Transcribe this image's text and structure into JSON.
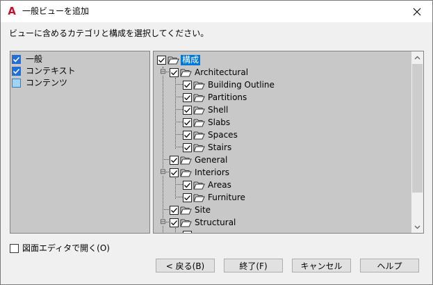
{
  "window": {
    "title": "一般ビューを追加",
    "logo_letter": "A",
    "close_icon": "close-icon"
  },
  "instruction": "ビューに含めるカテゴリと構成を選択してください。",
  "categories": [
    {
      "label": "一般",
      "checked": true
    },
    {
      "label": "コンテキスト",
      "checked": true
    },
    {
      "label": "コンテンツ",
      "checked": false
    }
  ],
  "tree": {
    "root": {
      "label": "構成",
      "checked": true,
      "selected": true
    },
    "nodes": [
      {
        "label": "Architectural",
        "checked": true
      },
      {
        "label": "Building Outline",
        "checked": true
      },
      {
        "label": "Partitions",
        "checked": true
      },
      {
        "label": "Shell",
        "checked": true
      },
      {
        "label": "Slabs",
        "checked": true
      },
      {
        "label": "Spaces",
        "checked": true
      },
      {
        "label": "Stairs",
        "checked": true
      },
      {
        "label": "General",
        "checked": true
      },
      {
        "label": "Interiors",
        "checked": true
      },
      {
        "label": "Areas",
        "checked": true
      },
      {
        "label": "Furniture",
        "checked": true
      },
      {
        "label": "Site",
        "checked": true
      },
      {
        "label": "Structural",
        "checked": true
      }
    ]
  },
  "open_editor": {
    "label": "図面エディタで開く(O)",
    "checked": false
  },
  "buttons": {
    "back": "< 戻る(B)",
    "finish": "終了(F)",
    "cancel": "キャンセル",
    "help": "ヘルプ"
  },
  "colors": {
    "accent": "#0078d7",
    "logo": "#c8102e",
    "panel": "#c8c8c8"
  }
}
